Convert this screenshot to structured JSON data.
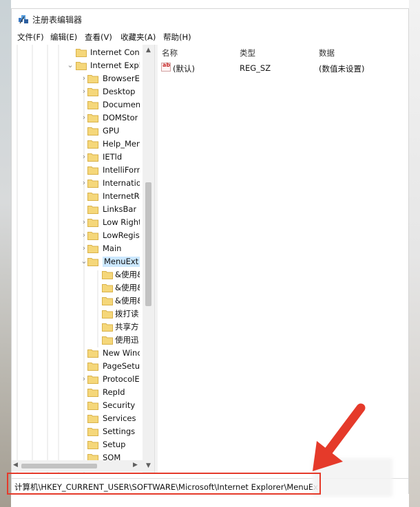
{
  "window": {
    "title": "注册表编辑器"
  },
  "menu": [
    "文件(F)",
    "编辑(E)",
    "查看(V)",
    "收藏夹(A)",
    "帮助(H)"
  ],
  "tree": [
    {
      "label": "Internet Conr",
      "depth": 0,
      "expander": "",
      "selected": false
    },
    {
      "label": "Internet Explo",
      "depth": 0,
      "expander": "v",
      "selected": false
    },
    {
      "label": "BrowserEı",
      "depth": 1,
      "expander": ">",
      "selected": false
    },
    {
      "label": "Desktop",
      "depth": 1,
      "expander": ">",
      "selected": false
    },
    {
      "label": "Document",
      "depth": 1,
      "expander": "",
      "selected": false
    },
    {
      "label": "DOMStor",
      "depth": 1,
      "expander": ">",
      "selected": false
    },
    {
      "label": "GPU",
      "depth": 1,
      "expander": "",
      "selected": false
    },
    {
      "label": "Help_Men",
      "depth": 1,
      "expander": "",
      "selected": false
    },
    {
      "label": "IETld",
      "depth": 1,
      "expander": ">",
      "selected": false
    },
    {
      "label": "IntelliForn",
      "depth": 1,
      "expander": "",
      "selected": false
    },
    {
      "label": "Internatio",
      "depth": 1,
      "expander": ">",
      "selected": false
    },
    {
      "label": "InternetRe",
      "depth": 1,
      "expander": "",
      "selected": false
    },
    {
      "label": "LinksBar",
      "depth": 1,
      "expander": "",
      "selected": false
    },
    {
      "label": "Low Right",
      "depth": 1,
      "expander": ">",
      "selected": false
    },
    {
      "label": "LowRegist",
      "depth": 1,
      "expander": ">",
      "selected": false
    },
    {
      "label": "Main",
      "depth": 1,
      "expander": ">",
      "selected": false
    },
    {
      "label": "MenuExt",
      "depth": 1,
      "expander": "v",
      "selected": true
    },
    {
      "label": "&使用&",
      "depth": 2,
      "expander": "",
      "selected": false
    },
    {
      "label": "&使用&",
      "depth": 2,
      "expander": "",
      "selected": false
    },
    {
      "label": "&使用&",
      "depth": 2,
      "expander": "",
      "selected": false
    },
    {
      "label": "拨打读",
      "depth": 2,
      "expander": "",
      "selected": false
    },
    {
      "label": "共享方",
      "depth": 2,
      "expander": "",
      "selected": false
    },
    {
      "label": "使用迅",
      "depth": 2,
      "expander": "",
      "selected": false
    },
    {
      "label": "New Winc",
      "depth": 1,
      "expander": "",
      "selected": false
    },
    {
      "label": "PageSetup",
      "depth": 1,
      "expander": "",
      "selected": false
    },
    {
      "label": "ProtocolE",
      "depth": 1,
      "expander": ">",
      "selected": false
    },
    {
      "label": "RepId",
      "depth": 1,
      "expander": "",
      "selected": false
    },
    {
      "label": "Security",
      "depth": 1,
      "expander": "",
      "selected": false
    },
    {
      "label": "Services",
      "depth": 1,
      "expander": "",
      "selected": false
    },
    {
      "label": "Settings",
      "depth": 1,
      "expander": "",
      "selected": false
    },
    {
      "label": "Setup",
      "depth": 1,
      "expander": "",
      "selected": false
    },
    {
      "label": "SQM",
      "depth": 1,
      "expander": "",
      "selected": false
    }
  ],
  "list": {
    "headers": {
      "name": "名称",
      "type": "类型",
      "data": "数据"
    },
    "rows": [
      {
        "icon": "string-value-icon",
        "icon_text": "ab",
        "name": "(默认)",
        "type": "REG_SZ",
        "data": "(数值未设置)"
      }
    ]
  },
  "status": {
    "path": "计算机\\HKEY_CURRENT_USER\\SOFTWARE\\Microsoft\\Internet Explorer\\MenuExt"
  },
  "colors": {
    "annotation_red": "#e53a2a",
    "folder_yellow": "#f5d77a",
    "selection_blue": "#cce8ff"
  }
}
